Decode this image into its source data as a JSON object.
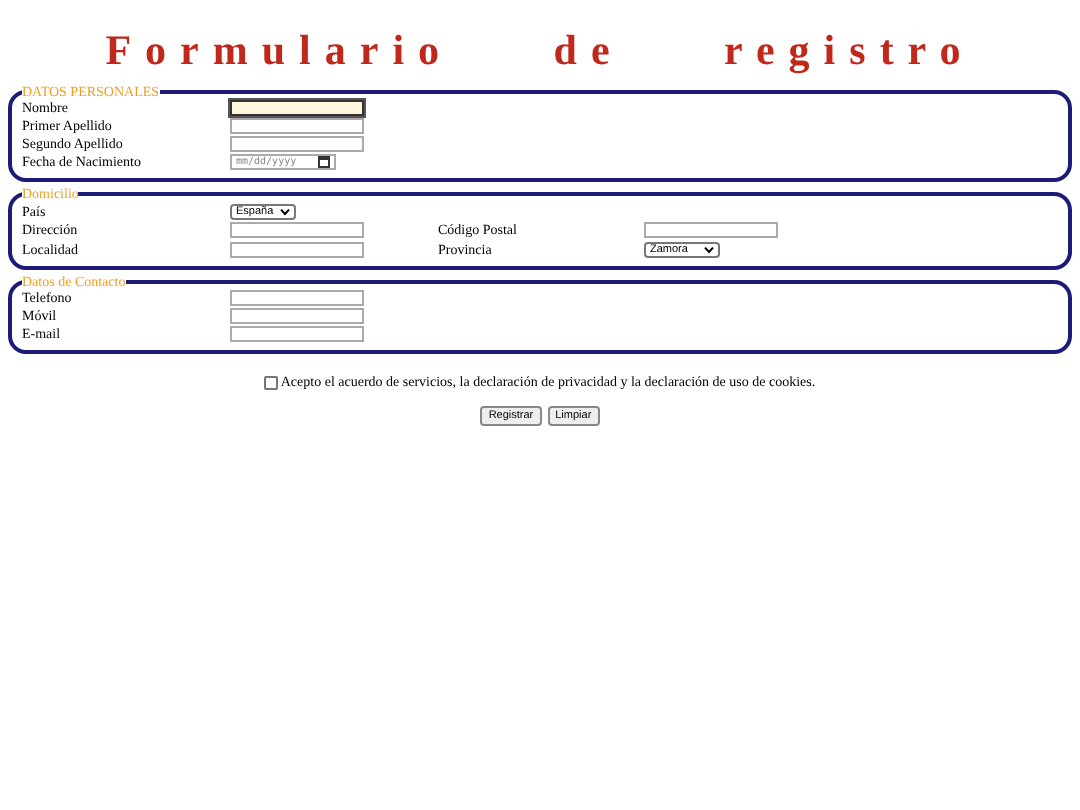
{
  "title": "Formulario de registro",
  "sections": [
    {
      "legend": "DATOS PERSONALES",
      "rows": [
        [
          {
            "label": "Nombre",
            "kind": "text",
            "focused": true
          }
        ],
        [
          {
            "label": "Primer Apellido",
            "kind": "text",
            "focused": false
          }
        ],
        [
          {
            "label": "Segundo Apellido",
            "kind": "text",
            "focused": false
          }
        ],
        [
          {
            "label": "Fecha de Nacimiento",
            "kind": "date",
            "placeholder": "mm/dd/yyyy",
            "focused": false
          }
        ]
      ]
    },
    {
      "legend": "Domicilio",
      "rows": [
        [
          {
            "label": "País",
            "kind": "select",
            "value": "España",
            "focused": false
          }
        ],
        [
          {
            "label": "Dirección",
            "kind": "text",
            "focused": false
          },
          {
            "label": "Código Postal",
            "kind": "text",
            "focused": false
          }
        ],
        [
          {
            "label": "Localidad",
            "kind": "text",
            "focused": false
          },
          {
            "label": "Provincia",
            "kind": "select",
            "value": "Zamora",
            "focused": false
          }
        ]
      ]
    },
    {
      "legend": "Datos de Contacto",
      "rows": [
        [
          {
            "label": "Telefono",
            "kind": "text",
            "focused": false
          }
        ],
        [
          {
            "label": "Móvil",
            "kind": "text",
            "focused": false
          }
        ],
        [
          {
            "label": "E-mail",
            "kind": "text",
            "focused": false
          }
        ]
      ]
    }
  ],
  "terms": {
    "label": "Acepto el acuerdo de servicios, la declaración de privacidad y la declaración de uso de cookies.",
    "checked": false
  },
  "buttons": [
    "Registrar",
    "Limpiar"
  ]
}
